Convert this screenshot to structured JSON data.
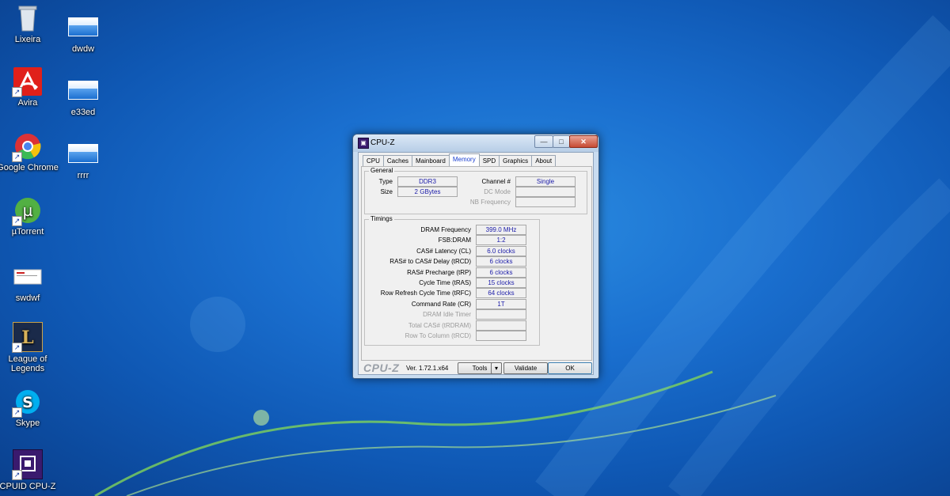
{
  "desktop": {
    "icons": [
      {
        "label": "Lixeira",
        "icon": "recycle-bin-icon"
      },
      {
        "label": "Avira",
        "icon": "avira-icon"
      },
      {
        "label": "Google Chrome",
        "icon": "chrome-icon"
      },
      {
        "label": "µTorrent",
        "icon": "utorrent-icon"
      },
      {
        "label": "swdwf",
        "icon": "document-thumbnail-icon"
      },
      {
        "label": "League of Legends",
        "icon": "league-of-legends-icon"
      },
      {
        "label": "Skype",
        "icon": "skype-icon"
      },
      {
        "label": "CPUID CPU-Z",
        "icon": "cpuz-icon"
      },
      {
        "label": "dwdw",
        "icon": "image-thumbnail-icon"
      },
      {
        "label": "e33ed",
        "icon": "image-thumbnail-icon"
      },
      {
        "label": "rrrr",
        "icon": "image-thumbnail-icon"
      }
    ]
  },
  "window": {
    "title": "CPU-Z",
    "controls": {
      "minimize": "—",
      "maximize": "□",
      "close": "✕"
    },
    "tabs": [
      "CPU",
      "Caches",
      "Mainboard",
      "Memory",
      "SPD",
      "Graphics",
      "About"
    ],
    "active_tab": "Memory",
    "general": {
      "title": "General",
      "type_label": "Type",
      "type_value": "DDR3",
      "size_label": "Size",
      "size_value": "2 GBytes",
      "channel_label": "Channel #",
      "channel_value": "Single",
      "dc_mode_label": "DC Mode",
      "dc_mode_value": "",
      "nb_freq_label": "NB Frequency",
      "nb_freq_value": ""
    },
    "timings": {
      "title": "Timings",
      "rows": [
        {
          "label": "DRAM Frequency",
          "value": "399.0 MHz"
        },
        {
          "label": "FSB:DRAM",
          "value": "1:2"
        },
        {
          "label": "CAS# Latency (CL)",
          "value": "6.0 clocks"
        },
        {
          "label": "RAS# to CAS# Delay (tRCD)",
          "value": "6 clocks"
        },
        {
          "label": "RAS# Precharge (tRP)",
          "value": "6 clocks"
        },
        {
          "label": "Cycle Time (tRAS)",
          "value": "15 clocks"
        },
        {
          "label": "Row Refresh Cycle Time (tRFC)",
          "value": "64 clocks"
        },
        {
          "label": "Command Rate (CR)",
          "value": "1T"
        },
        {
          "label": "DRAM Idle Timer",
          "value": ""
        },
        {
          "label": "Total CAS# (tRDRAM)",
          "value": ""
        },
        {
          "label": "Row To Column (tRCD)",
          "value": ""
        }
      ]
    },
    "footer": {
      "logo": "CPU-Z",
      "version": "Ver. 1.72.1.x64",
      "tools_label": "Tools",
      "validate_label": "Validate",
      "ok_label": "OK"
    }
  }
}
